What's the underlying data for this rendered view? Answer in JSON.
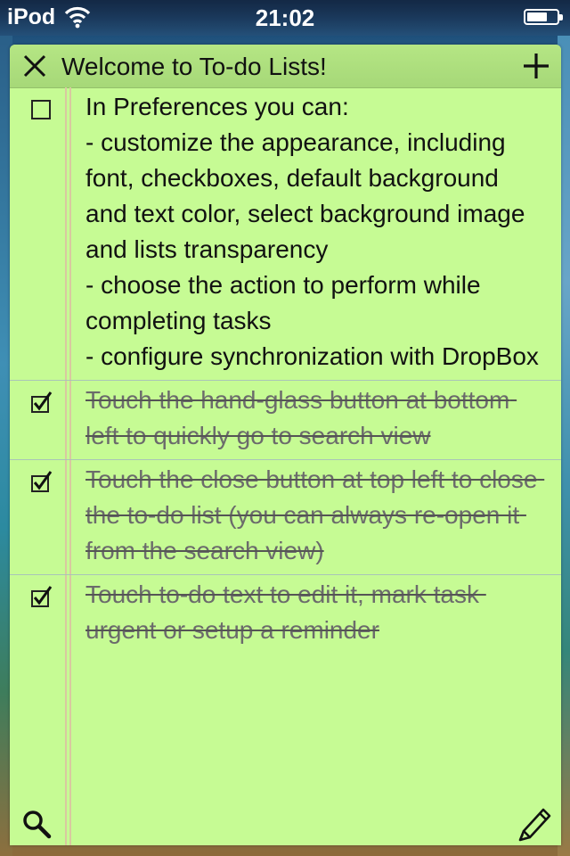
{
  "status_bar": {
    "carrier": "iPod",
    "time": "21:02",
    "wifi_icon": "wifi-icon",
    "battery_icon": "battery-icon",
    "battery_level": 0.7
  },
  "list": {
    "title": "Welcome to To-do Lists!",
    "background_color": "#c6fb94",
    "header_icons": {
      "close": "close-icon",
      "add": "plus-icon"
    },
    "items": [
      {
        "text": "In Preferences you can:\n- customize the appearance, including font, checkboxes, default background and text color, select background image and lists transparency\n- choose the action to perform while completing tasks\n- configure synchronization with DropBox",
        "completed": false
      },
      {
        "text": "Touch the hand-glass button at bottom left to quickly go to search view",
        "completed": true
      },
      {
        "text": "Touch the close button at top left to close the to-do list (you can always re-open it from the search view)",
        "completed": true
      },
      {
        "text": "Touch to-do text to edit it, mark task urgent or setup a reminder",
        "completed": true
      }
    ],
    "footer_icons": {
      "search": "search-icon",
      "edit": "pencil-icon"
    }
  }
}
